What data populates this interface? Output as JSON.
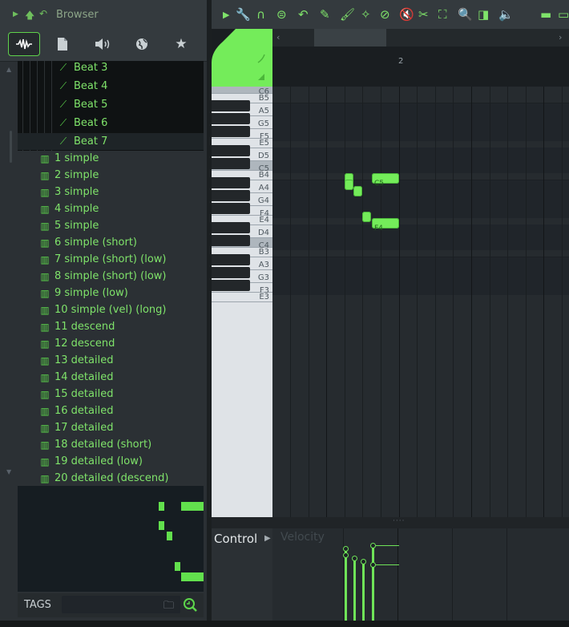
{
  "browser": {
    "title": "Browser",
    "tabs": [
      {
        "name": "all",
        "icon": "waveform-icon",
        "active": true
      },
      {
        "name": "files",
        "icon": "file-icon"
      },
      {
        "name": "speaker",
        "icon": "speaker-icon"
      },
      {
        "name": "online",
        "icon": "globe-icon"
      },
      {
        "name": "favorites",
        "icon": "star-icon"
      }
    ],
    "beats": [
      "Beat 3",
      "Beat 4",
      "Beat 5",
      "Beat 6",
      "Beat 7"
    ],
    "scores": [
      "1 simple",
      "2 simple",
      "3 simple",
      "4 simple",
      "5 simple",
      "6 simple (short)",
      "7 simple (short) (low)",
      "8 simple (short) (low)",
      "9 simple (low)",
      "10 simple (vel) (long)",
      "11 descend",
      "12 descend",
      "13 detailed",
      "14 detailed",
      "15 detailed",
      "16 detailed",
      "17 detailed",
      "18 detailed (short)",
      "19 detailed (low)",
      "20 detailed (descend)"
    ],
    "tags_label": "TAGS"
  },
  "piano_roll": {
    "bar_label": "2",
    "key_labels": [
      "C6",
      "B5",
      "A5",
      "G5",
      "F5",
      "E5",
      "D5",
      "C5",
      "B4",
      "A4",
      "G4",
      "F4",
      "E4",
      "D4",
      "C4",
      "B3",
      "A3",
      "G3",
      "F3",
      "E3"
    ],
    "notes": [
      {
        "pitch": "C5",
        "start": 0,
        "length": 0.1,
        "label": ""
      },
      {
        "pitch": "C5",
        "start": 0.3,
        "length": 0.3,
        "label": "C5"
      },
      {
        "pitch": "B4",
        "start": 0,
        "length": 0.1,
        "label": ""
      },
      {
        "pitch": "A#4",
        "start": 0.1,
        "length": 0.1,
        "label": ""
      },
      {
        "pitch": "F#4",
        "start": 0.2,
        "length": 0.1,
        "label": ""
      },
      {
        "pitch": "F4",
        "start": 0.3,
        "length": 0.3,
        "label": "F4"
      }
    ],
    "control_label": "Control",
    "control_target": "Velocity"
  },
  "colors": {
    "accent": "#5dd64b",
    "note": "#74ec5a",
    "background": "#262b2f"
  }
}
